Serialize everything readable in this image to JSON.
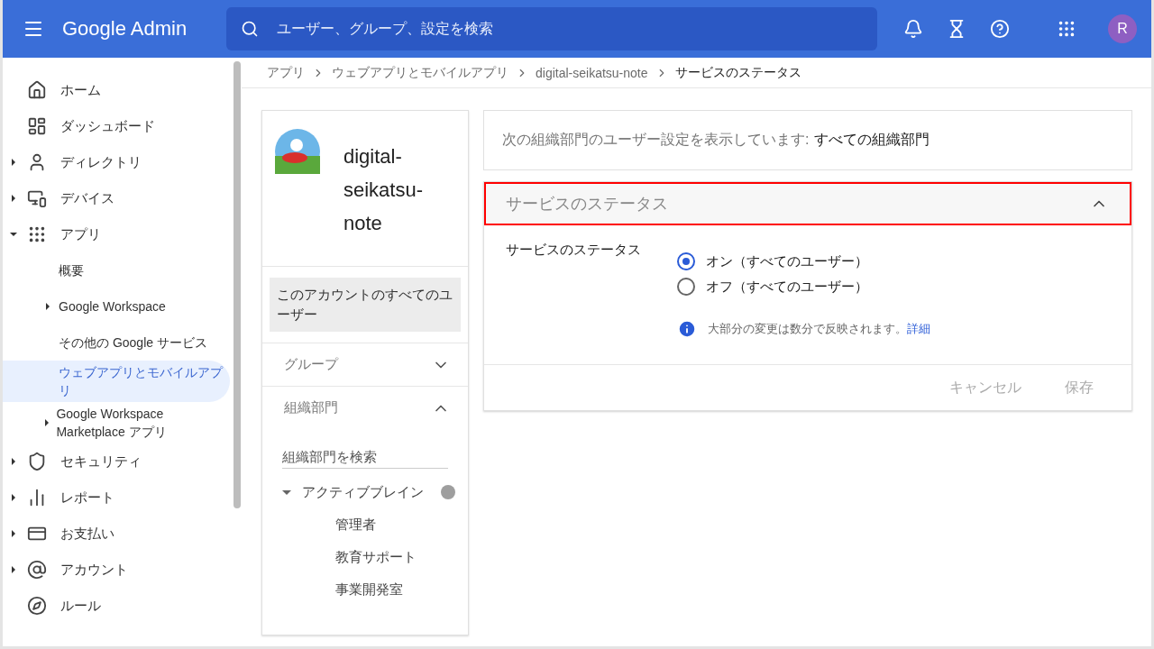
{
  "header": {
    "product": "Google Admin",
    "search": {
      "placeholder": "ユーザー、グループ、設定を検索"
    },
    "avatar": "R"
  },
  "sidebar": {
    "items": [
      {
        "label": "ホーム",
        "selected": false
      },
      {
        "label": "ダッシュボード",
        "selected": false
      },
      {
        "label": "ディレクトリ",
        "selected": false,
        "expanded": false
      },
      {
        "label": "デバイス",
        "selected": false,
        "expanded": false
      },
      {
        "label": "アプリ",
        "selected": false,
        "expanded": true,
        "children": [
          {
            "label": "概要",
            "selected": false
          },
          {
            "label": "Google Workspace",
            "selected": false,
            "expanded": false
          },
          {
            "label": "その他の Google サービス",
            "selected": false
          },
          {
            "label": "ウェブアプリとモバイルアプリ",
            "selected": true
          },
          {
            "label": "Google Workspace Marketplace アプリ",
            "selected": false,
            "expanded": false
          }
        ]
      },
      {
        "label": "セキュリティ",
        "selected": false,
        "expanded": false
      },
      {
        "label": "レポート",
        "selected": false,
        "expanded": false
      },
      {
        "label": "お支払い",
        "selected": false,
        "expanded": false
      },
      {
        "label": "アカウント",
        "selected": false,
        "expanded": false
      },
      {
        "label": "ルール",
        "selected": false
      }
    ]
  },
  "breadcrumb": [
    "アプリ",
    "ウェブアプリとモバイルアプリ",
    "digital-seikatsu-note",
    "サービスのステータス"
  ],
  "app_panel": {
    "name": "digital-seikatsu-note",
    "scope": {
      "label": "このアカウントのすべてのユーザー",
      "selected": true
    },
    "sections": [
      {
        "label": "グループ",
        "expanded": false
      },
      {
        "label": "組織部門",
        "expanded": true
      }
    ],
    "org_search": {
      "placeholder": "組織部門を検索"
    },
    "org_tree": [
      {
        "label": "アクティブブレイン",
        "expanded": true,
        "children": [
          {
            "label": "管理者"
          },
          {
            "label": "教育サポート"
          },
          {
            "label": "事業開発室"
          }
        ]
      }
    ]
  },
  "org_notice": {
    "prefix": "次の組織部門のユーザー設定を表示しています:",
    "value": "すべての組織部門"
  },
  "service_status": {
    "title": "サービスのステータス",
    "expanded": true,
    "label": "サービスのステータス",
    "options": [
      {
        "label": "オン（すべてのユーザー）",
        "selected": true
      },
      {
        "label": "オフ（すべてのユーザー）",
        "selected": false
      }
    ],
    "info": "大部分の変更は数分で反映されます。",
    "info_link": "詳細",
    "buttons": [
      {
        "label": "キャンセル",
        "disabled": true
      },
      {
        "label": "保存",
        "disabled": true
      }
    ]
  }
}
